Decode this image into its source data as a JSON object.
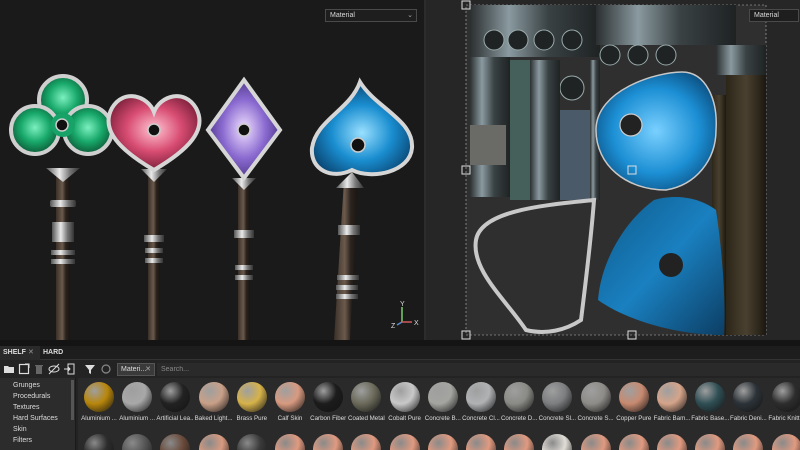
{
  "viewport3d": {
    "material_select": "Material"
  },
  "viewport2d": {
    "material_select": "Material"
  },
  "gizmo": {
    "x": "X",
    "y": "Y",
    "z": "Z"
  },
  "shelf": {
    "tabs": [
      {
        "label": "SHELF",
        "close": "✕"
      },
      {
        "label": "HARD SURFACES"
      }
    ],
    "filter_chip": {
      "label": "Materi...",
      "close": "✕"
    },
    "search_placeholder": "Search...",
    "categories": [
      "Grunges",
      "Procedurals",
      "Textures",
      "Hard Surfaces",
      "Skin",
      "Filters"
    ],
    "materials": [
      {
        "label": "Aluminium ...",
        "color": "#b8860b"
      },
      {
        "label": "Aluminium ...",
        "color": "#a8a8a8"
      },
      {
        "label": "Artificial Lea...",
        "color": "#222222"
      },
      {
        "label": "Baked Light...",
        "color": "#c9a088"
      },
      {
        "label": "Brass Pure",
        "color": "#d6b24a"
      },
      {
        "label": "Calf Skin",
        "color": "#d89a80"
      },
      {
        "label": "Carbon Fiber",
        "color": "#1c1c1c"
      },
      {
        "label": "Coated Metal",
        "color": "#6b6a5a"
      },
      {
        "label": "Cobalt Pure",
        "color": "#c8c8c8"
      },
      {
        "label": "Concrete B...",
        "color": "#a4a4a0"
      },
      {
        "label": "Concrete Cl...",
        "color": "#b0b2b4"
      },
      {
        "label": "Concrete D...",
        "color": "#8a8a86"
      },
      {
        "label": "Concrete Sl...",
        "color": "#7c7e80"
      },
      {
        "label": "Concrete S...",
        "color": "#8e8c88"
      },
      {
        "label": "Copper Pure",
        "color": "#c88a70"
      },
      {
        "label": "Fabric Bam...",
        "color": "#d5a48a"
      },
      {
        "label": "Fabric Base...",
        "color": "#2f4f55"
      },
      {
        "label": "Fabric Deni...",
        "color": "#2c3338"
      },
      {
        "label": "Fabric Knitt...",
        "color": "#2d2d2d"
      }
    ]
  }
}
